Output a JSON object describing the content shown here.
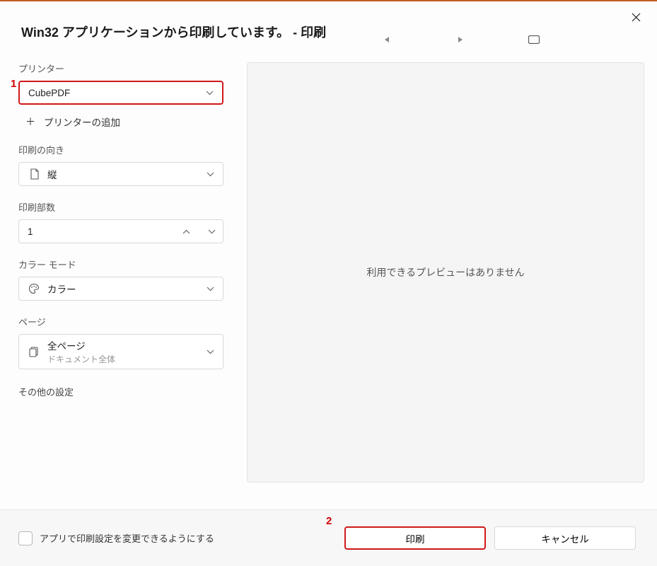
{
  "title": "Win32 アプリケーションから印刷しています。 - 印刷",
  "printer": {
    "label": "プリンター",
    "value": "CubePDF",
    "add_label": "プリンターの追加"
  },
  "orientation": {
    "label": "印刷の向き",
    "value": "縦"
  },
  "copies": {
    "label": "印刷部数",
    "value": "1"
  },
  "color_mode": {
    "label": "カラー モード",
    "value": "カラー"
  },
  "pages": {
    "label": "ページ",
    "value": "全ページ",
    "sub": "ドキュメント全体"
  },
  "other_settings": "その他の設定",
  "preview_message": "利用できるプレビューはありません",
  "footer": {
    "checkbox_label": "アプリで印刷設定を変更できるようにする",
    "print": "印刷",
    "cancel": "キャンセル"
  },
  "annotations": {
    "one": "1",
    "two": "2"
  }
}
